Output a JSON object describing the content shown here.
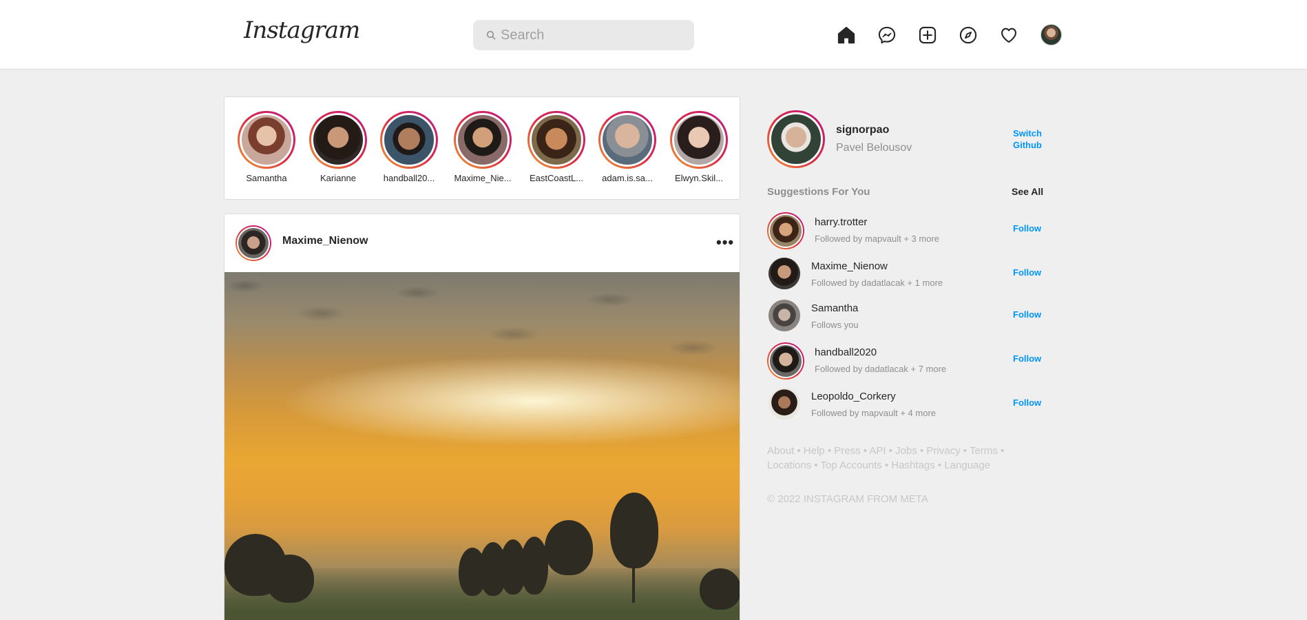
{
  "app": {
    "logo": "Instagram"
  },
  "search": {
    "placeholder": "Search"
  },
  "nav": [
    "home-icon",
    "messenger-icon",
    "new-post-icon",
    "explore-icon",
    "activity-heart-icon",
    "profile-avatar"
  ],
  "stories": [
    {
      "name": "Samantha"
    },
    {
      "name": "Karianne"
    },
    {
      "name": "handball20..."
    },
    {
      "name": "Maxime_Nie..."
    },
    {
      "name": "EastCoastL..."
    },
    {
      "name": "adam.is.sa..."
    },
    {
      "name": "Elwyn.Skil..."
    }
  ],
  "post": {
    "username": "Maxime_Nienow",
    "more": "•••"
  },
  "profile": {
    "username": "signorpao",
    "full_name": "Pavel Belousov",
    "switch_label": "Switch",
    "github_label": "Github"
  },
  "suggestions": {
    "title": "Suggestions For You",
    "see_all": "See All",
    "follow_label": "Follow",
    "items": [
      {
        "username": "harry.trotter",
        "subtitle": "Followed by mapvault + 3 more"
      },
      {
        "username": "Maxime_Nienow",
        "subtitle": "Followed by dadatlacak + 1 more"
      },
      {
        "username": "Samantha",
        "subtitle": "Follows you"
      },
      {
        "username": "handball2020",
        "subtitle": "Followed by dadatlacak + 7 more"
      },
      {
        "username": "Leopoldo_Corkery",
        "subtitle": "Followed by mapvault + 4 more"
      }
    ]
  },
  "footer": {
    "links": [
      "About",
      "Help",
      "Press",
      "API",
      "Jobs",
      "Privacy",
      "Terms",
      "Locations",
      "Top Accounts",
      "Hashtags",
      "Language"
    ],
    "copyright": "© 2022 INSTAGRAM FROM META"
  },
  "colors": {
    "link": "#0095f6",
    "story_ring": "#dc2743",
    "background": "#efefef"
  }
}
